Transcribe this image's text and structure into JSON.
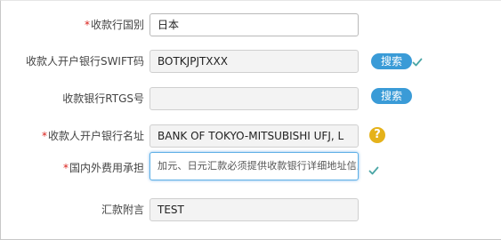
{
  "form": {
    "country": {
      "required": true,
      "label": "收款行国别",
      "value": "日本"
    },
    "swift": {
      "required": false,
      "label": "收款人开户银行SWIFT码",
      "value": "BOTKJPJTXXX",
      "button": "搜索",
      "valid": true
    },
    "rtgs": {
      "required": false,
      "label": "收款银行RTGS号",
      "value": "",
      "button": "搜索"
    },
    "bank_name": {
      "required": true,
      "label": "收款人开户银行名址",
      "value": "BANK OF TOKYO-MITSUBISHI UFJ, L",
      "help_icon": "?"
    },
    "fee": {
      "required": true,
      "label": "国内外费用承担",
      "placeholder": "加元、日元汇款必须提供收款银行详细地址信息",
      "valid": true
    },
    "remark": {
      "required": false,
      "label": "汇款附言",
      "value": "TEST"
    }
  },
  "colors": {
    "required_star": "#d9201b",
    "button_blue": "#3a9bd7",
    "check_teal": "#4aa6a6",
    "help_yellow": "#e5b21a",
    "focus_border": "#5fb0e6"
  },
  "required_mark": "*"
}
